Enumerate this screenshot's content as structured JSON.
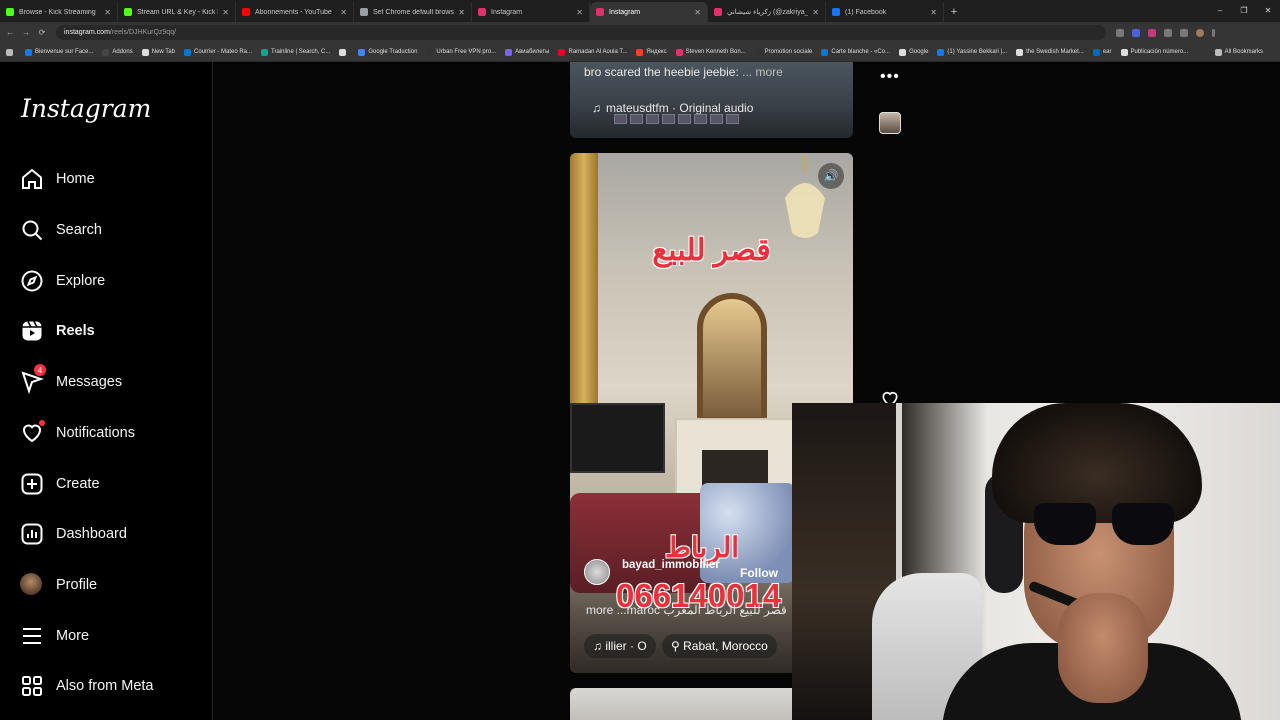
{
  "browser": {
    "tabs": [
      {
        "title": "Browse - Kick Streaming",
        "color": "#53fc18"
      },
      {
        "title": "Stream URL & Key - Kick Dashb...",
        "color": "#53fc18"
      },
      {
        "title": "Abonnements - YouTube",
        "color": "#ff0000"
      },
      {
        "title": "Set Chrome default browser",
        "color": "#9aa0a6"
      },
      {
        "title": "Instagram",
        "color": "#e1306c"
      },
      {
        "title": "Instagram",
        "color": "#e1306c",
        "active": true
      },
      {
        "title": "زكرياء شيشاني (@zakriya_t_jewiri...",
        "color": "#e1306c"
      },
      {
        "title": "(1) Facebook",
        "color": "#1877f2"
      }
    ],
    "new_tab": "+",
    "window_controls": [
      "–",
      "❐",
      "✕"
    ],
    "url_host": "instagram.com",
    "url_path": "/reels/DJHKurQz9qq/",
    "bookmarks": [
      {
        "label": "Bienvenue sur Face...",
        "color": "#1877f2"
      },
      {
        "label": "Addons",
        "color": "#444"
      },
      {
        "label": "New Tab",
        "color": "#ddd"
      },
      {
        "label": "Courrier - Mateo Ra...",
        "color": "#0078d4"
      },
      {
        "label": "Trainline | Search, C...",
        "color": "#00a88f"
      },
      {
        "label": "",
        "color": "#ddd"
      },
      {
        "label": "Google Traduction",
        "color": "#4285f4"
      },
      {
        "label": "Urban Free VPN pro...",
        "color": "#333"
      },
      {
        "label": "Авиабилеты",
        "color": "#7b61ff"
      },
      {
        "label": "Ramadan Al Aoula T...",
        "color": "#e4002b"
      },
      {
        "label": "Яндекс",
        "color": "#fc3f1d"
      },
      {
        "label": "Steven Kenneth Bon...",
        "color": "#e1306c"
      },
      {
        "label": "Promotion sociale",
        "color": "#333"
      },
      {
        "label": "Carte blanche - «Co...",
        "color": "#0078d4"
      },
      {
        "label": "Google",
        "color": "#ddd"
      },
      {
        "label": "(1) Yassine Bekkari |...",
        "color": "#1877f2"
      },
      {
        "label": "the Swedish Market...",
        "color": "#ddd"
      },
      {
        "label": "ear",
        "color": "#0a66c2"
      },
      {
        "label": "Publicación número...",
        "color": "#ddd"
      }
    ],
    "all_bookmarks": "All Bookmarks"
  },
  "sidebar": {
    "logo": "Instagram",
    "items": [
      {
        "label": "Home",
        "icon": "home-icon"
      },
      {
        "label": "Search",
        "icon": "search-icon"
      },
      {
        "label": "Explore",
        "icon": "compass-icon"
      },
      {
        "label": "Reels",
        "icon": "reels-icon",
        "active": true
      },
      {
        "label": "Messages",
        "icon": "messenger-icon",
        "badge": "4"
      },
      {
        "label": "Notifications",
        "icon": "heart-icon"
      },
      {
        "label": "Create",
        "icon": "plus-square-icon"
      },
      {
        "label": "Dashboard",
        "icon": "dashboard-icon"
      },
      {
        "label": "Profile",
        "icon": "avatar"
      },
      {
        "label": "More",
        "icon": "menu-icon"
      },
      {
        "label": "Also from Meta",
        "icon": "meta-grid-icon"
      }
    ]
  },
  "reel_prev": {
    "caption": "bro scared the heebie jeebie:",
    "more": "... more",
    "audio": "mateusdtfm · Original audio"
  },
  "reel_current": {
    "title_ar": "قصر للبيع",
    "city_ar": "الرباط",
    "phone": "066140014",
    "author": "bayad_immobilier",
    "follow": "Follow",
    "caption": "more ...maroc قصر للبيع الرباط المغرب",
    "audio": "illier · O",
    "location": "Rabat, Morocco"
  },
  "actions": {
    "more_dots": "•••"
  }
}
